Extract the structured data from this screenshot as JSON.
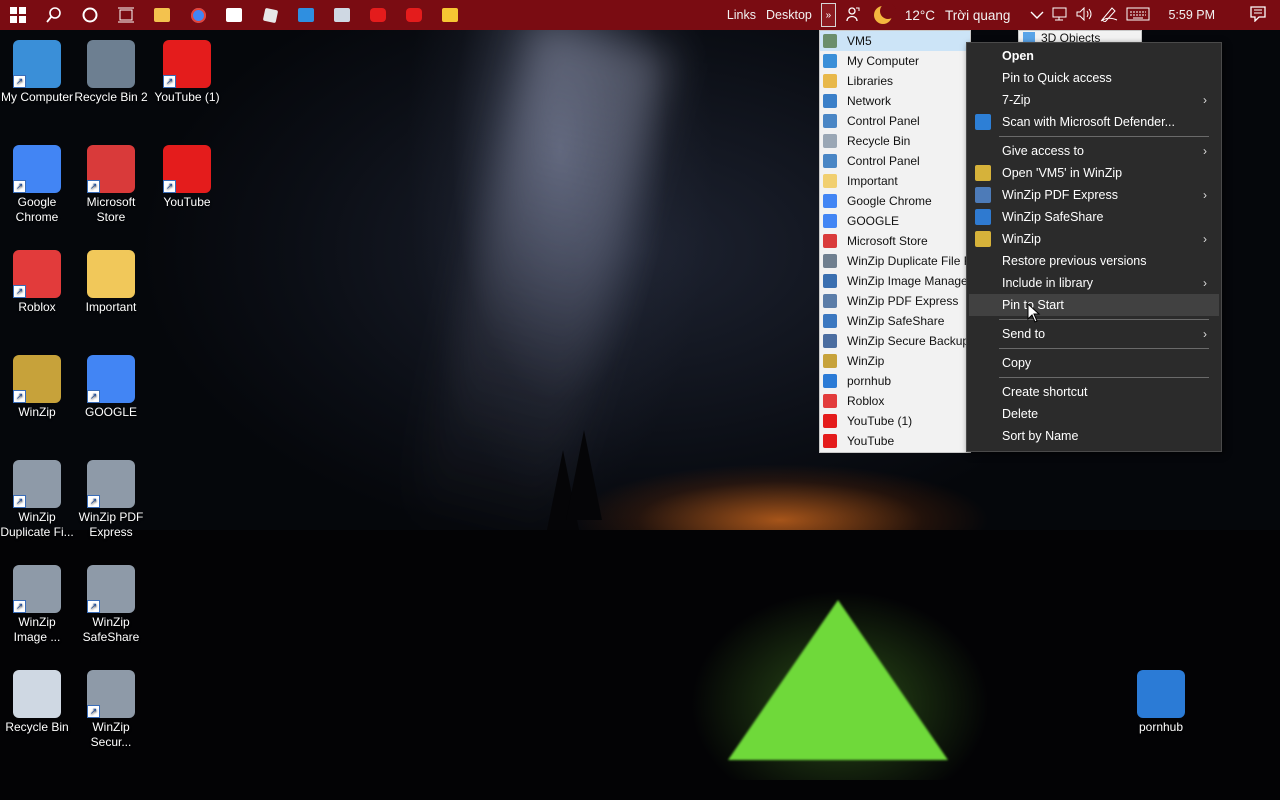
{
  "taskbar": {
    "links_label": "Links",
    "desktop_label": "Desktop",
    "overflow_glyph": "»",
    "temperature": "12°C",
    "weather_text": "Trời quang",
    "time": "5:59 PM",
    "accent_color": "#7a0c12"
  },
  "desktop_icons": [
    {
      "label": "My Computer",
      "color": "#3a8fd8"
    },
    {
      "label": "Recycle Bin 2",
      "color": "#6d7f91"
    },
    {
      "label": "YouTube (1)",
      "color": "#e41c1c"
    },
    {
      "label": "Google Chrome",
      "color": "#4285f4"
    },
    {
      "label": "Microsoft Store",
      "color": "#d93a3a"
    },
    {
      "label": "YouTube",
      "color": "#e41c1c"
    },
    {
      "label": "Roblox",
      "color": "#e23b3b"
    },
    {
      "label": "Important",
      "color": "#f1c85a"
    },
    {
      "label": "WinZip",
      "color": "#c7a23a"
    },
    {
      "label": "GOOGLE",
      "color": "#4285f4"
    },
    {
      "label": "WinZip Duplicate Fi...",
      "color": "#8e9aa8"
    },
    {
      "label": "WinZip PDF Express",
      "color": "#8e9aa8"
    },
    {
      "label": "WinZip Image ...",
      "color": "#8e9aa8"
    },
    {
      "label": "WinZip SafeShare",
      "color": "#8e9aa8"
    },
    {
      "label": "Recycle Bin",
      "color": "#cfd8e3"
    },
    {
      "label": "WinZip Secur...",
      "color": "#8e9aa8"
    },
    {
      "label": "pornhub",
      "color": "#2b7bd6"
    }
  ],
  "vm_list": {
    "items": [
      {
        "label": "VM5",
        "color": "#6b8e6b"
      },
      {
        "label": "My Computer",
        "color": "#3a8fd8"
      },
      {
        "label": "Libraries",
        "color": "#e8b84a"
      },
      {
        "label": "Network",
        "color": "#3a7fc8"
      },
      {
        "label": "Control Panel",
        "color": "#4a86c5"
      },
      {
        "label": "Recycle Bin",
        "color": "#9aa7b5"
      },
      {
        "label": "Control Panel",
        "color": "#4a86c5"
      },
      {
        "label": "Important",
        "color": "#f1cf70"
      },
      {
        "label": "Google Chrome",
        "color": "#4285f4"
      },
      {
        "label": "GOOGLE",
        "color": "#4285f4"
      },
      {
        "label": "Microsoft Store",
        "color": "#d93a3a"
      },
      {
        "label": "WinZip Duplicate File F",
        "color": "#6f7f8f"
      },
      {
        "label": "WinZip Image Manage",
        "color": "#3a6fb0"
      },
      {
        "label": "WinZip PDF Express",
        "color": "#5b7da8"
      },
      {
        "label": "WinZip SafeShare",
        "color": "#3b78c0"
      },
      {
        "label": "WinZip Secure Backup",
        "color": "#4b6da0"
      },
      {
        "label": "WinZip",
        "color": "#c7a23a"
      },
      {
        "label": "pornhub",
        "color": "#2b7bd6"
      },
      {
        "label": "Roblox",
        "color": "#e23b3b"
      },
      {
        "label": "YouTube (1)",
        "color": "#e41c1c"
      },
      {
        "label": "YouTube",
        "color": "#e41c1c"
      }
    ],
    "selected_index": 0,
    "side_item_label": "3D Objects"
  },
  "context_menu": {
    "items": [
      {
        "label": "Open",
        "bold": true,
        "arrow": false,
        "icon": ""
      },
      {
        "label": "Pin to Quick access",
        "arrow": false,
        "icon": ""
      },
      {
        "label": "7-Zip",
        "arrow": true,
        "icon": ""
      },
      {
        "label": "Scan with Microsoft Defender...",
        "arrow": false,
        "icon": "defender-shield-icon"
      },
      {
        "separator": true
      },
      {
        "label": "Give access to",
        "arrow": true,
        "icon": ""
      },
      {
        "label": "Open 'VM5' in WinZip",
        "arrow": false,
        "icon": "winzip-icon"
      },
      {
        "label": "WinZip PDF Express",
        "arrow": true,
        "icon": "pdf-icon"
      },
      {
        "label": "WinZip SafeShare",
        "arrow": false,
        "icon": "safeshare-icon"
      },
      {
        "label": "WinZip",
        "arrow": true,
        "icon": "winzip-icon"
      },
      {
        "label": "Restore previous versions",
        "arrow": false,
        "icon": ""
      },
      {
        "label": "Include in library",
        "arrow": true,
        "icon": ""
      },
      {
        "label": "Pin to Start",
        "arrow": false,
        "icon": "",
        "hover": true
      },
      {
        "separator": true
      },
      {
        "label": "Send to",
        "arrow": true,
        "icon": ""
      },
      {
        "separator": true
      },
      {
        "label": "Copy",
        "arrow": false,
        "icon": ""
      },
      {
        "separator": true
      },
      {
        "label": "Create shortcut",
        "arrow": false,
        "icon": ""
      },
      {
        "label": "Delete",
        "arrow": false,
        "icon": ""
      },
      {
        "label": "Sort by Name",
        "arrow": false,
        "icon": ""
      }
    ],
    "arrow_glyph": "›"
  }
}
